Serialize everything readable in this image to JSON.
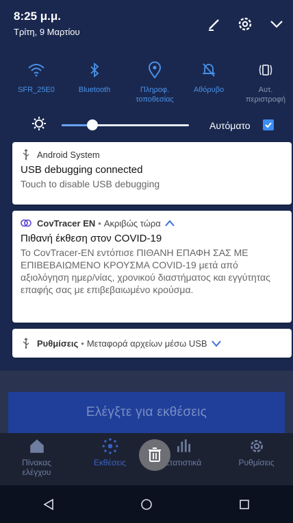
{
  "status": {
    "time": "8:25 μ.μ.",
    "date": "Τρίτη, 9 Μαρτίου"
  },
  "header_icons": [
    "edit-icon",
    "settings-icon",
    "chevron-down-icon"
  ],
  "quick_settings": [
    {
      "label": "SFR_25E0",
      "icon": "wifi-icon",
      "active": true
    },
    {
      "label": "Bluetooth",
      "icon": "bluetooth-icon",
      "active": true
    },
    {
      "label": "Πληροφ.\nτοποθεσίας",
      "icon": "location-icon",
      "active": true
    },
    {
      "label": "Αθόρυβο",
      "icon": "mute-icon",
      "active": true
    },
    {
      "label": "Αυτ.\nπεριστροφή",
      "icon": "rotate-icon",
      "active": false
    }
  ],
  "brightness": {
    "level": 0.24,
    "auto_label": "Αυτόματο",
    "auto_checked": true
  },
  "notifications": [
    {
      "app": "Android System",
      "meta": "",
      "title": "USB debugging connected",
      "body": "Touch to disable USB debugging",
      "icon": "usb-icon",
      "expanded": false
    },
    {
      "app": "CovTracer EN",
      "meta": "Ακριβώς τώρα",
      "title": "Πιθανή έκθεση στον COVID-19",
      "body": "Το CovTracer-EN εντόπισε ΠΙΘΑΝΗ ΕΠΑΦΗ ΣΑΣ ΜΕ ΕΠΙΒΕΒΑΙΩΜΕΝΟ ΚΡΟΥΣΜΑ COVID-19 μετά από αξιολόγηση ημερ/νίας, χρονικού διαστήματος και εγγύτητας επαφής σας με επιβεβαιωμένο κρούσμα.",
      "icon": "covtracer-icon",
      "expanded": true
    },
    {
      "app": "Ρυθμίσεις",
      "meta": "Μεταφορά αρχείων μέσω USB",
      "title": "",
      "body": "",
      "icon": "usb-icon",
      "expanded": false
    }
  ],
  "background_app": {
    "cta_label": "Ελέγξτε για εκθέσεις",
    "nav": [
      {
        "label": "Πίνακας ελέγχου",
        "icon": "home-icon"
      },
      {
        "label": "Εκθέσεις",
        "icon": "exposures-icon",
        "active": true
      },
      {
        "label": "Στατιστικά",
        "icon": "stats-icon"
      },
      {
        "label": "Ρυθμίσεις",
        "icon": "gear-icon"
      }
    ]
  },
  "colors": {
    "shade_bg": "#1a284f",
    "accent": "#4a92e8",
    "card_bg": "#ffffff"
  }
}
